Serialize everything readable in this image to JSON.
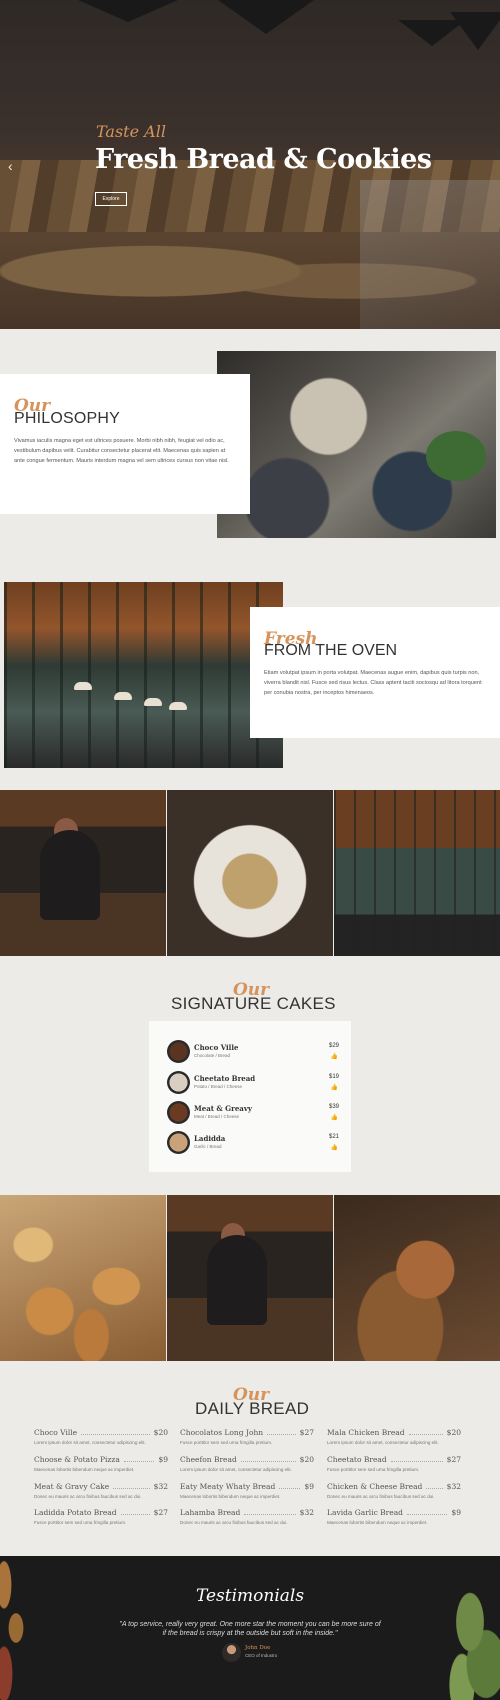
{
  "hero": {
    "subtitle": "Taste All",
    "title": "Fresh Bread & Cookies",
    "button": "Explore",
    "prev_arrow": "‹"
  },
  "philosophy": {
    "our": "Our",
    "heading": "PHILOSOPHY",
    "body": "Vivamus iaculis magna eget est ultrices posuere. Morbi nibh nibh, feugiat vel odio ac, vestibulum dapibus velit. Curabitur consectetur placerat elit. Maecenas quis sapien at ante congue fermentum. Mauris interdum magna vel sem ultrices cursus non vitae nisl."
  },
  "oven": {
    "our": "Fresh",
    "heading": "FROM THE OVEN",
    "body": "Etiam volutpat ipsum in porta volutpat. Maecenas augue enim, dapibus quis turpis non, viverra blandit nisl. Fusce sed risus lectus. Class aptent taciti sociosqu ad litora torquent per conubia nostra, per inceptos himenaeos."
  },
  "signature": {
    "our": "Our",
    "heading": "SIGNATURE CAKES",
    "items": [
      {
        "name": "Choco Ville",
        "desc": "Chocolate / Bread",
        "price": "$29",
        "thumb_color": "#5a3420"
      },
      {
        "name": "Cheetato Bread",
        "desc": "Potato / Bread / Cheese",
        "price": "$19",
        "thumb_color": "#d8cfc2"
      },
      {
        "name": "Meat & Greavy",
        "desc": "Meat / Bread / Cheese",
        "price": "$39",
        "thumb_color": "#6a3a22"
      },
      {
        "name": "Ladidda",
        "desc": "Garlic / Bread",
        "price": "$21",
        "thumb_color": "#c9a27a"
      }
    ],
    "like_icon": "thumbs-up-icon"
  },
  "daily": {
    "our": "Our",
    "heading": "DAILY BREAD",
    "items": [
      {
        "name": "Choco Ville",
        "price": "$20",
        "desc": "Lorem ipsum dolor sit amet, consectetur adipiscing elit."
      },
      {
        "name": "Chocolatos Long John",
        "price": "$27",
        "desc": "Fusce porttitor sem sed urna fringilla pretium."
      },
      {
        "name": "Mala Chicken Bread",
        "price": "$20",
        "desc": "Lorem ipsum dolor sit amet, consectetur adipiscing elit."
      },
      {
        "name": "Choose & Potato Pizza",
        "price": "$9",
        "desc": "Maecenas lobortis bibendum neque ac imperdiet."
      },
      {
        "name": "Cheefon Bread",
        "price": "$20",
        "desc": "Lorem ipsum dolor sit amet, consectetur adipiscing elit."
      },
      {
        "name": "Cheetato Bread",
        "price": "$27",
        "desc": "Fusce porttitor sem sed urna fringilla pretium."
      },
      {
        "name": "Meat & Gravy Cake",
        "price": "$32",
        "desc": "Donec eu mauris ac arcu finibus faucibus sed ac dui."
      },
      {
        "name": "Eaty Meaty Whaty Bread",
        "price": "$9",
        "desc": "Maecenas lobortis bibendum neque ac imperdiet."
      },
      {
        "name": "Chicken & Cheese Bread",
        "price": "$32",
        "desc": "Donec eu mauris ac arcu finibus faucibus sed ac dui."
      },
      {
        "name": "Ladidda Potato Bread",
        "price": "$27",
        "desc": "Fusce porttitor sem sed urna fringilla pretium."
      },
      {
        "name": "Lahamba Bread",
        "price": "$32",
        "desc": "Donec eu mauris ac arcu finibus faucibus sed ac dui."
      },
      {
        "name": "Lavida Garlic Bread",
        "price": "$9",
        "desc": "Maecenas lobortis bibendum neque ac imperdiet."
      }
    ]
  },
  "testimonials": {
    "title": "Testimonials",
    "quote": "\"A top service, really very great. One more star the moment you can be more sure of if the bread is crispy at the outside but soft in the inside.\"",
    "author": "John Doe",
    "role": "CEO of Industro"
  },
  "colors": {
    "accent": "#d5945d",
    "background": "#ecebe7",
    "dark": "#1b1b1b"
  }
}
